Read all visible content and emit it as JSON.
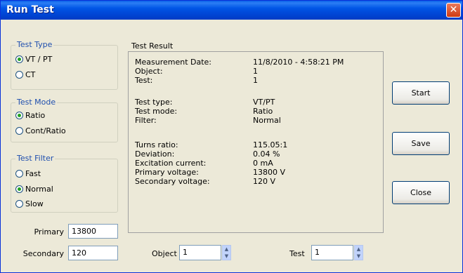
{
  "window": {
    "title": "Run Test",
    "close_glyph": "✕"
  },
  "test_type": {
    "label": "Test Type",
    "options": [
      "VT / PT",
      "CT"
    ],
    "selected": 0
  },
  "test_mode": {
    "label": "Test Mode",
    "options": [
      "Ratio",
      "Cont/Ratio"
    ],
    "selected": 0
  },
  "test_filter": {
    "label": "Test Filter",
    "options": [
      "Fast",
      "Normal",
      "Slow"
    ],
    "selected": 1
  },
  "primary": {
    "label": "Primary",
    "value": "13800"
  },
  "secondary": {
    "label": "Secondary",
    "value": "120"
  },
  "result": {
    "title": "Test Result",
    "rows": [
      {
        "label": "Measurement Date:",
        "value": "11/8/2010 - 4:58:21 PM"
      },
      {
        "label": "Object:",
        "value": "1"
      },
      {
        "label": "Test:",
        "value": "1"
      },
      {
        "label": "Test type:",
        "value": "VT/PT"
      },
      {
        "label": "Test mode:",
        "value": "Ratio"
      },
      {
        "label": "Filter:",
        "value": "Normal"
      },
      {
        "label": "Turns ratio:",
        "value": "115.05:1"
      },
      {
        "label": "Deviation:",
        "value": "0.04 %"
      },
      {
        "label": "Excitation current:",
        "value": "0 mA"
      },
      {
        "label": "Primary voltage:",
        "value": "13800 V"
      },
      {
        "label": "Secondary voltage:",
        "value": "120 V"
      }
    ]
  },
  "buttons": {
    "start": "Start",
    "save": "Save",
    "close": "Close"
  },
  "object_spin": {
    "label": "Object",
    "value": "1"
  },
  "test_spin": {
    "label": "Test",
    "value": "1"
  },
  "icons": {
    "spin_up": "▲",
    "spin_down": "▼"
  }
}
